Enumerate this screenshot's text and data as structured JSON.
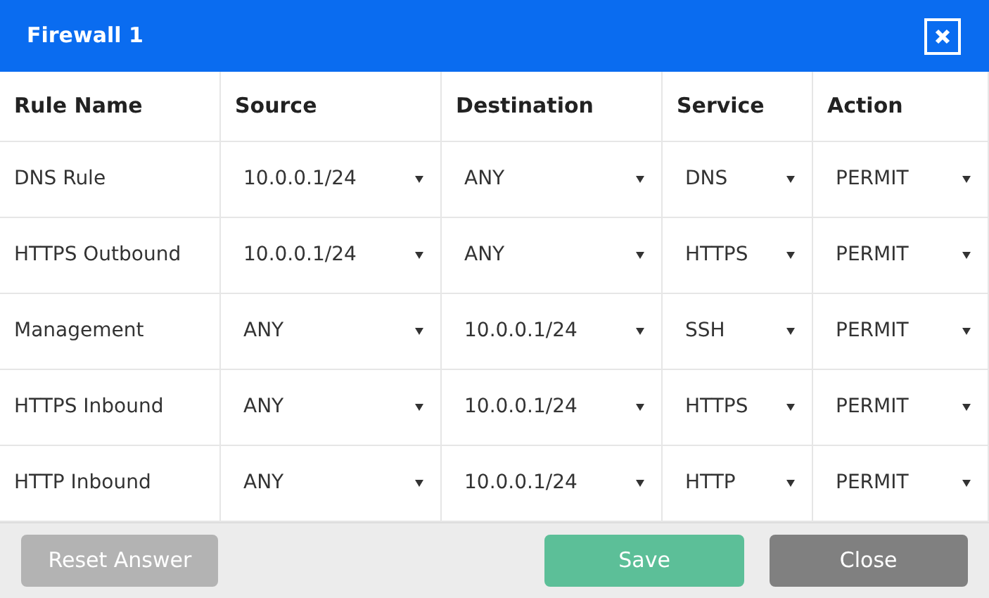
{
  "window": {
    "title": "Firewall 1"
  },
  "table": {
    "columns": [
      "Rule Name",
      "Source",
      "Destination",
      "Service",
      "Action"
    ],
    "rows": [
      {
        "name": "DNS Rule",
        "source": "10.0.0.1/24",
        "destination": "ANY",
        "service": "DNS",
        "action": "PERMIT"
      },
      {
        "name": "HTTPS Outbound",
        "source": "10.0.0.1/24",
        "destination": "ANY",
        "service": "HTTPS",
        "action": "PERMIT"
      },
      {
        "name": "Management",
        "source": "ANY",
        "destination": "10.0.0.1/24",
        "service": "SSH",
        "action": "PERMIT"
      },
      {
        "name": "HTTPS Inbound",
        "source": "ANY",
        "destination": "10.0.0.1/24",
        "service": "HTTPS",
        "action": "PERMIT"
      },
      {
        "name": "HTTP Inbound",
        "source": "ANY",
        "destination": "10.0.0.1/24",
        "service": "HTTP",
        "action": "PERMIT"
      }
    ]
  },
  "buttons": [
    {
      "label": "Reset Answer",
      "kind": "reset"
    },
    {
      "label": "Save",
      "kind": "save"
    },
    {
      "label": "Close",
      "kind": "close"
    }
  ]
}
